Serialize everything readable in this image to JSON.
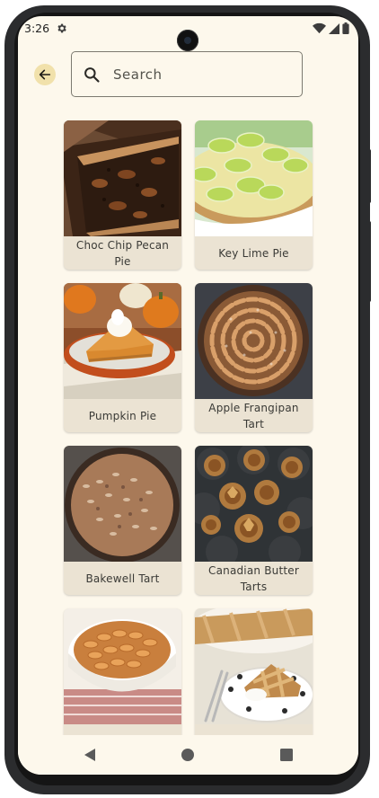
{
  "status_bar": {
    "time": "3:26",
    "icons": [
      "settings-gear-icon",
      "wifi-icon",
      "cellular-signal-icon",
      "battery-icon"
    ]
  },
  "top_bar": {
    "back_icon": "arrow-back-icon",
    "search_icon": "search-icon",
    "search_placeholder": "Search",
    "search_value": ""
  },
  "recipes": [
    {
      "title": "Choc Chip Pecan Pie"
    },
    {
      "title": "Key Lime Pie"
    },
    {
      "title": "Pumpkin Pie"
    },
    {
      "title": "Apple Frangipan Tart"
    },
    {
      "title": "Bakewell Tart"
    },
    {
      "title": "Canadian Butter Tarts"
    },
    {
      "title": ""
    },
    {
      "title": ""
    }
  ],
  "nav_bar": {
    "icons": [
      "back-triangle-icon",
      "home-circle-icon",
      "recents-square-icon"
    ]
  },
  "colors": {
    "background": "#fdf8ec",
    "card": "#ebe3d3",
    "back_button": "#f1e1ab",
    "search_border": "#7c7a70"
  }
}
